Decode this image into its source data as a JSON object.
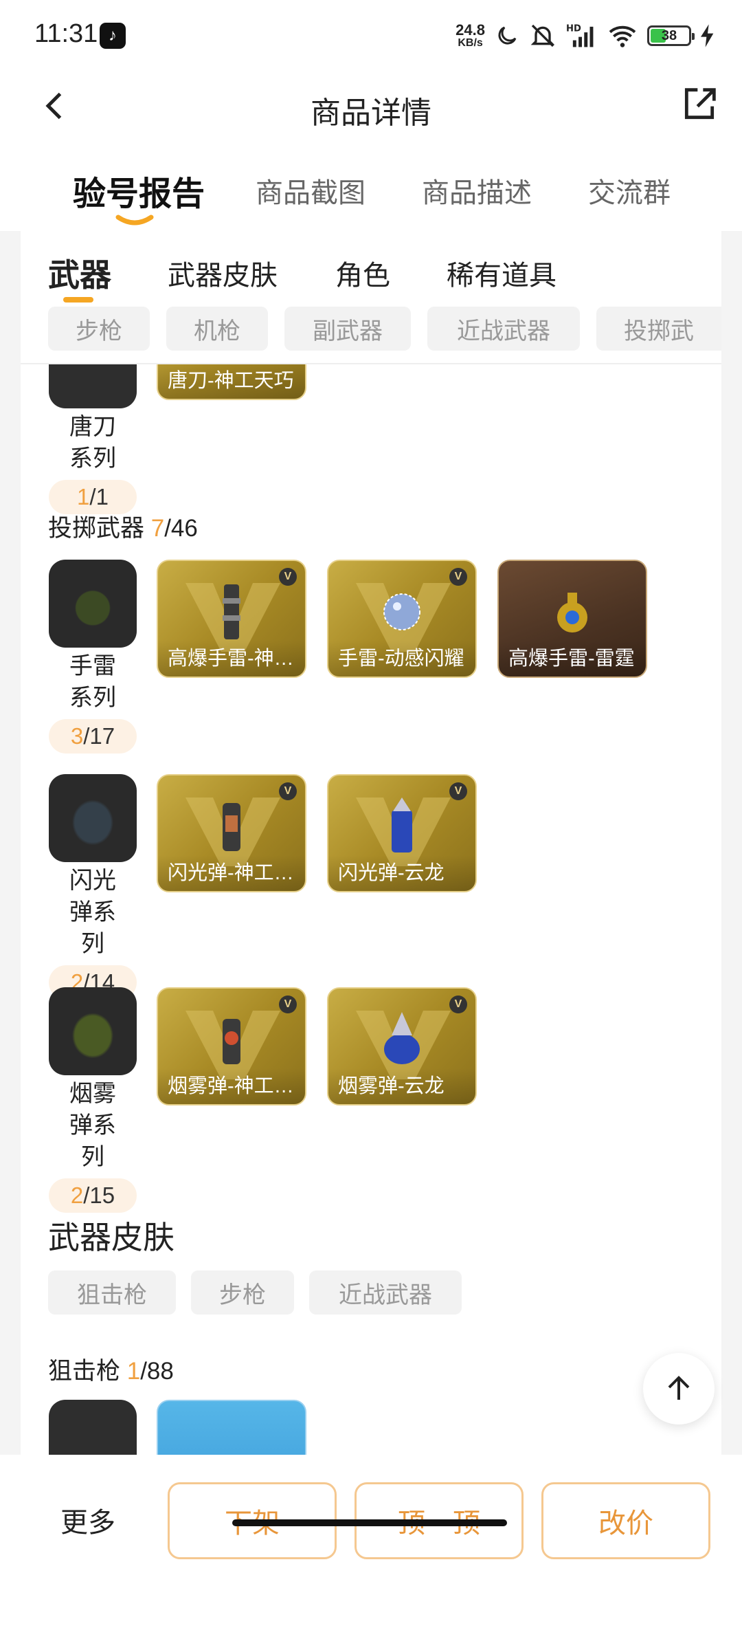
{
  "status_bar": {
    "time": "11:31",
    "net_speed_value": "24.8",
    "net_speed_unit": "KB/s",
    "battery_level": "38",
    "icons": [
      "tiktok-icon",
      "moon-icon",
      "mute-icon",
      "hd-signal-icon",
      "wifi-icon",
      "battery-icon",
      "charging-icon"
    ]
  },
  "nav": {
    "title": "商品详情",
    "back_icon": "chevron-left-icon",
    "share_icon": "share-icon"
  },
  "main_tabs": [
    {
      "label": "验号报告",
      "active": true
    },
    {
      "label": "商品截图",
      "active": false
    },
    {
      "label": "商品描述",
      "active": false
    },
    {
      "label": "交流群",
      "active": false
    }
  ],
  "sub_tabs": [
    {
      "label": "武器",
      "active": true
    },
    {
      "label": "武器皮肤",
      "active": false
    },
    {
      "label": "角色",
      "active": false
    },
    {
      "label": "稀有道具",
      "active": false
    }
  ],
  "weapon_chips": [
    "步枪",
    "机枪",
    "副武器",
    "近战武器",
    "投掷武"
  ],
  "tang_series": {
    "name": "唐刀系列",
    "owned": "1",
    "total": "/1",
    "item": "唐刀-神工天巧"
  },
  "throwing_section": {
    "title": "投掷武器 ",
    "owned": "7",
    "total": "/46"
  },
  "grenade_series": {
    "name": "手雷系列",
    "owned": "3",
    "total": "/17",
    "items": [
      "高爆手雷-神工天巧",
      "手雷-动感闪耀",
      "高爆手雷-雷霆"
    ]
  },
  "flash_series": {
    "name": "闪光弹系列",
    "owned": "2",
    "total": "/14",
    "items": [
      "闪光弹-神工天巧",
      "闪光弹-云龙"
    ]
  },
  "smoke_series": {
    "name": "烟雾弹系列",
    "owned": "2",
    "total": "/15",
    "items": [
      "烟雾弹-神工天巧",
      "烟雾弹-云龙"
    ]
  },
  "skin_section": {
    "heading": "武器皮肤",
    "chips": [
      "狙击枪",
      "步枪",
      "近战武器"
    ]
  },
  "sniper_section": {
    "title": "狙击枪 ",
    "owned": "1",
    "total": "/88"
  },
  "bottom_bar": {
    "more": "更多",
    "delist": "下架",
    "bump": "顶一顶",
    "reprice": "改价"
  },
  "colors": {
    "accent": "#f5a623",
    "gold_card": "#b0922e",
    "button_border": "#f5c890",
    "button_text": "#e8963a"
  }
}
